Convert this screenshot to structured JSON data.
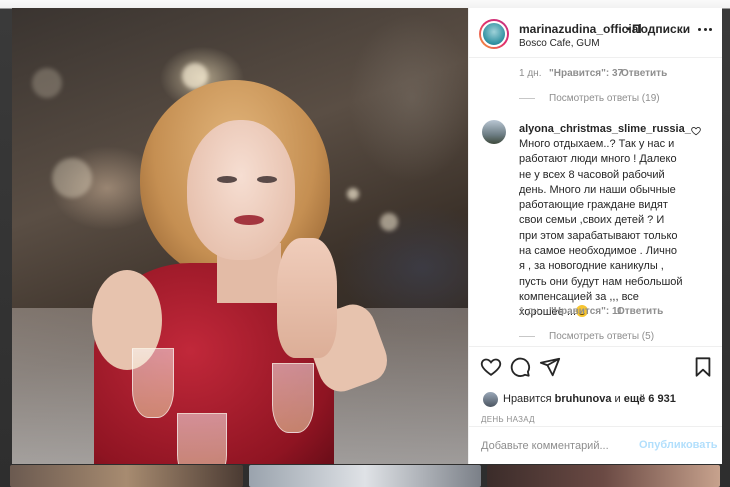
{
  "post": {
    "username": "marinazudina_official",
    "separator": "•",
    "follow_label": "Подписки",
    "location": "Bosco Cafe, GUM"
  },
  "comments": {
    "prev_meta": {
      "time": "1 дн.",
      "likes": "\"Нравится\": 37",
      "reply": "Ответить"
    },
    "prev_view_replies": "Посмотреть ответы (19)",
    "comment": {
      "username": "alyona_christmas_slime_russia_",
      "text": "Много отдыхаем..? Так у нас и работают люди много ! Далеко не у всех 8 часовой рабочий день. Много ли наши обычные работающие граждане видят свои семьи ,своих детей ? И при этом зарабатывают только на самое необходимое . Лично я , за новогодние каникулы , пусть они будут нам небольшой компенсацией за ,,, все хорошее ...",
      "time": "1 дн.",
      "likes": "\"Нравится\": 11",
      "reply": "Ответить",
      "view_replies": "Посмотреть ответы (5)"
    }
  },
  "likes": {
    "prefix": "Нравится",
    "user": "bruhunova",
    "middle": "и",
    "rest": "ещё 6 931"
  },
  "post_date": "ДЕНЬ НАЗАД",
  "comment_box": {
    "placeholder": "Добавьте комментарий...",
    "publish_label": "Опубликовать"
  },
  "icons": {
    "more": "more-icon",
    "heart": "heart-icon",
    "comment": "comment-icon",
    "share": "share-icon",
    "save": "bookmark-icon",
    "emoji": "grinning-face-emoji"
  },
  "colors": {
    "link_disabled": "#b2dffc",
    "muted_text": "#8e8e8e",
    "primary_text": "#262626"
  }
}
